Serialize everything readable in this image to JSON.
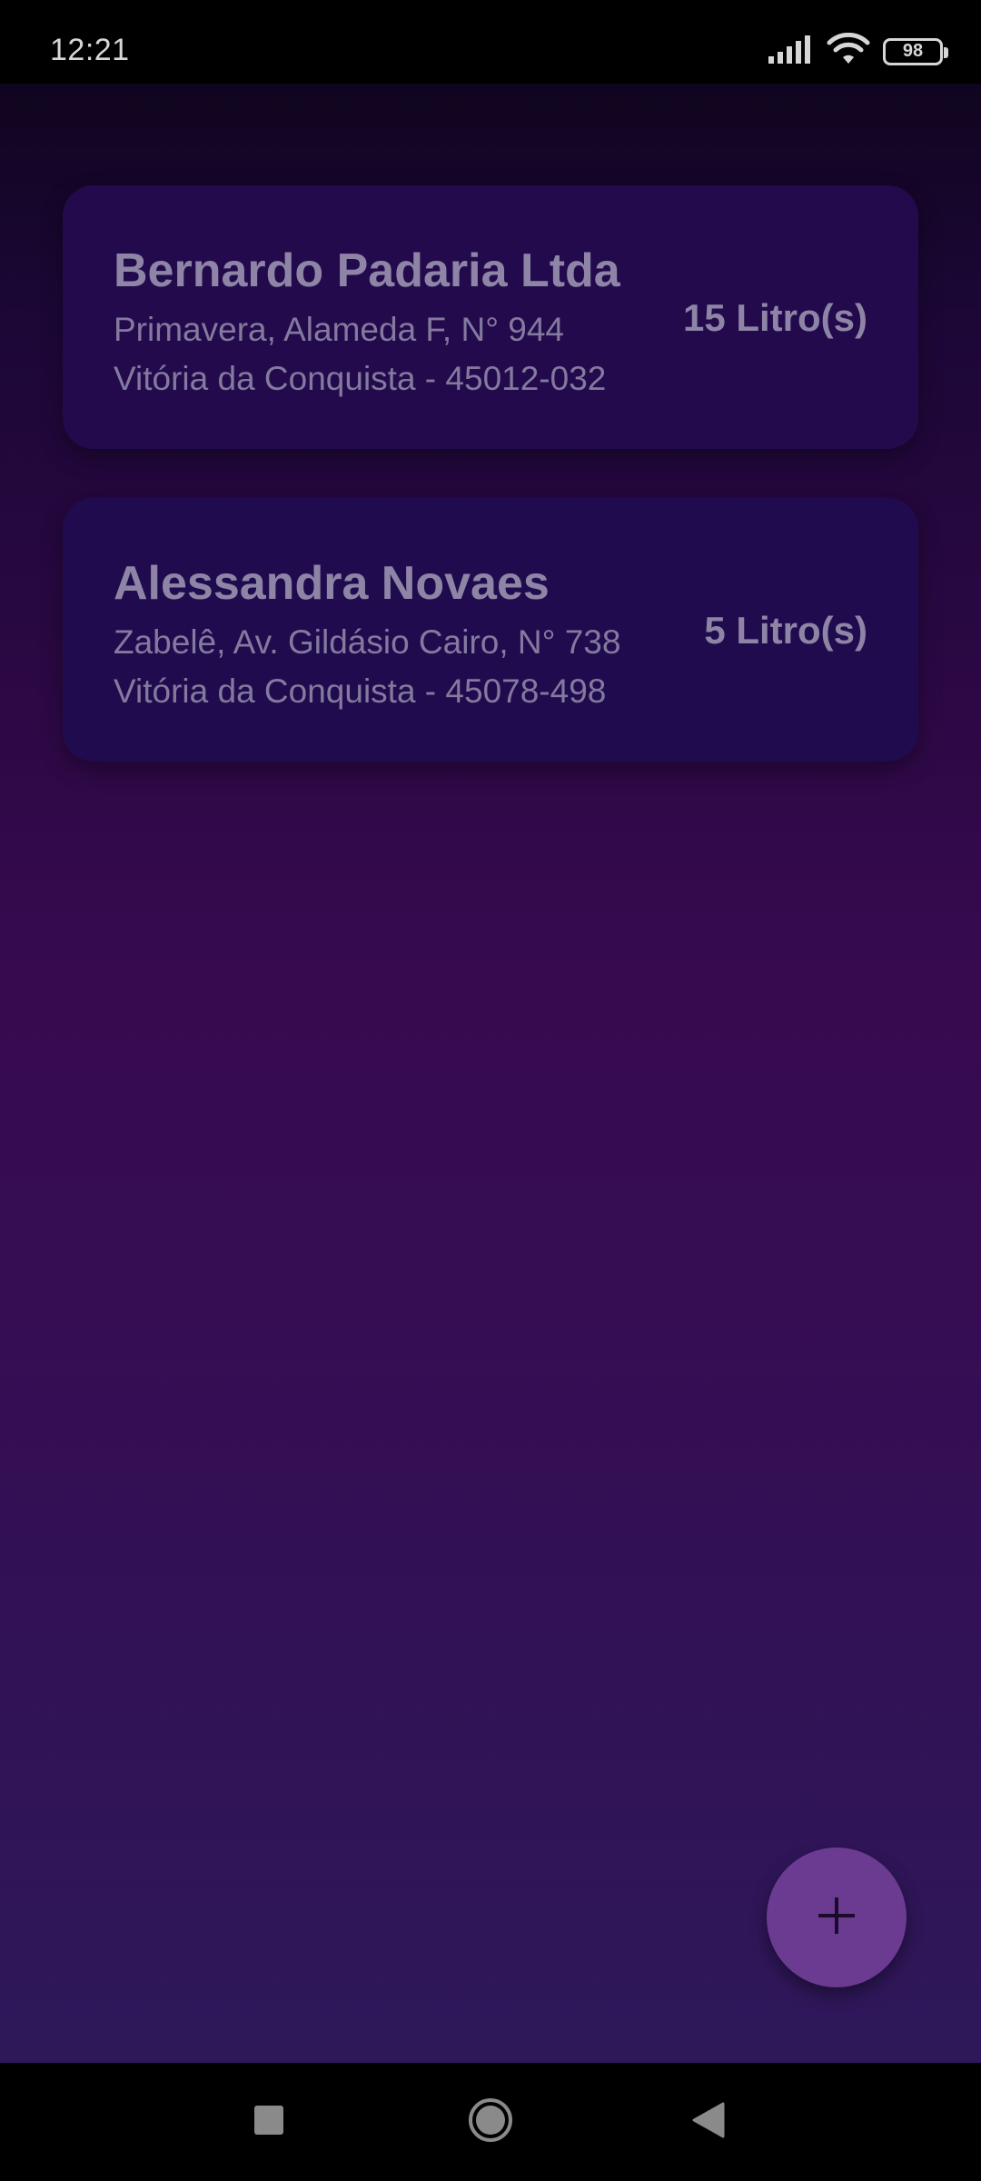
{
  "status_bar": {
    "time": "12:21",
    "battery_level": "98",
    "icons": [
      "signal-icon",
      "wifi-icon",
      "battery-icon"
    ]
  },
  "deliveries": [
    {
      "name": "Bernardo Padaria Ltda",
      "address": "Primavera, Alameda F, N° 944",
      "city": "Vitória da Conquista - 45012-032",
      "quantity": "15 Litro(s)"
    },
    {
      "name": "Alessandra Novaes",
      "address": "Zabelê, Av. Gildásio Cairo, N° 738",
      "city": "Vitória da Conquista - 45078-498",
      "quantity": "5 Litro(s)"
    }
  ],
  "fab": {
    "icon": "plus-icon"
  },
  "navigation": {
    "buttons": [
      "recents-icon",
      "home-icon",
      "back-icon"
    ]
  },
  "colors": {
    "background_top": "#10051f",
    "background_bottom": "#2e185a",
    "card": "#220a4c",
    "card_text": "#8e85a6",
    "fab": "#6b3a91"
  }
}
